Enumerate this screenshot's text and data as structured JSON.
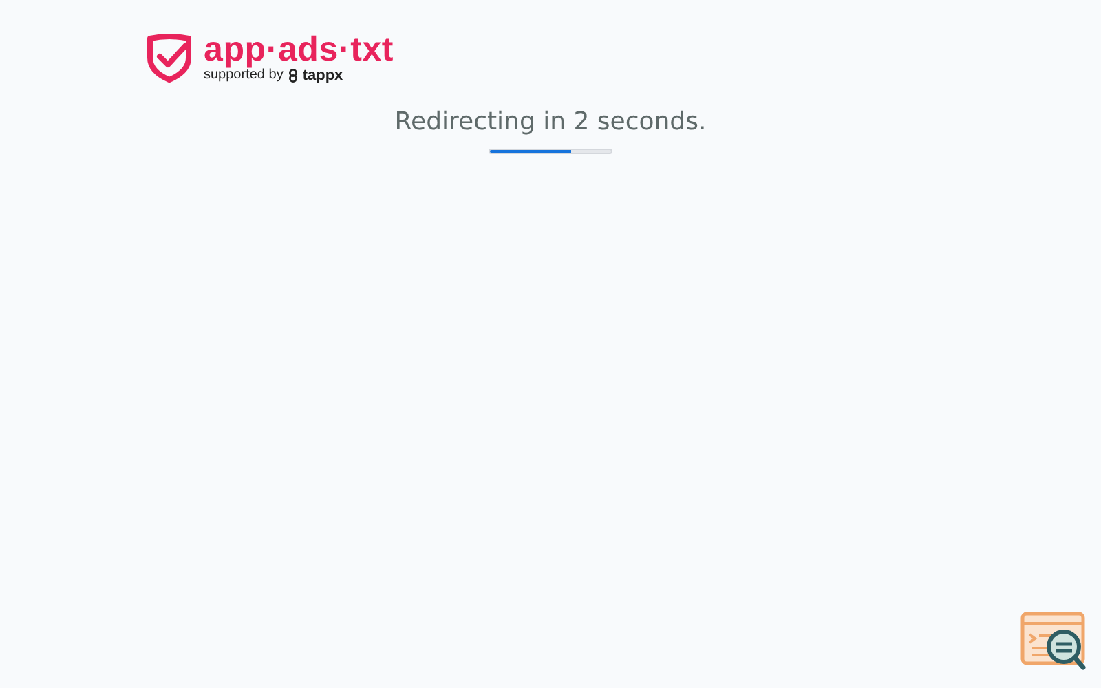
{
  "logo": {
    "name": "app·ads·txt",
    "tagline": "supported by",
    "partner": "tappx"
  },
  "redirect": {
    "message": "Redirecting in 2 seconds.",
    "level": 0.67
  }
}
